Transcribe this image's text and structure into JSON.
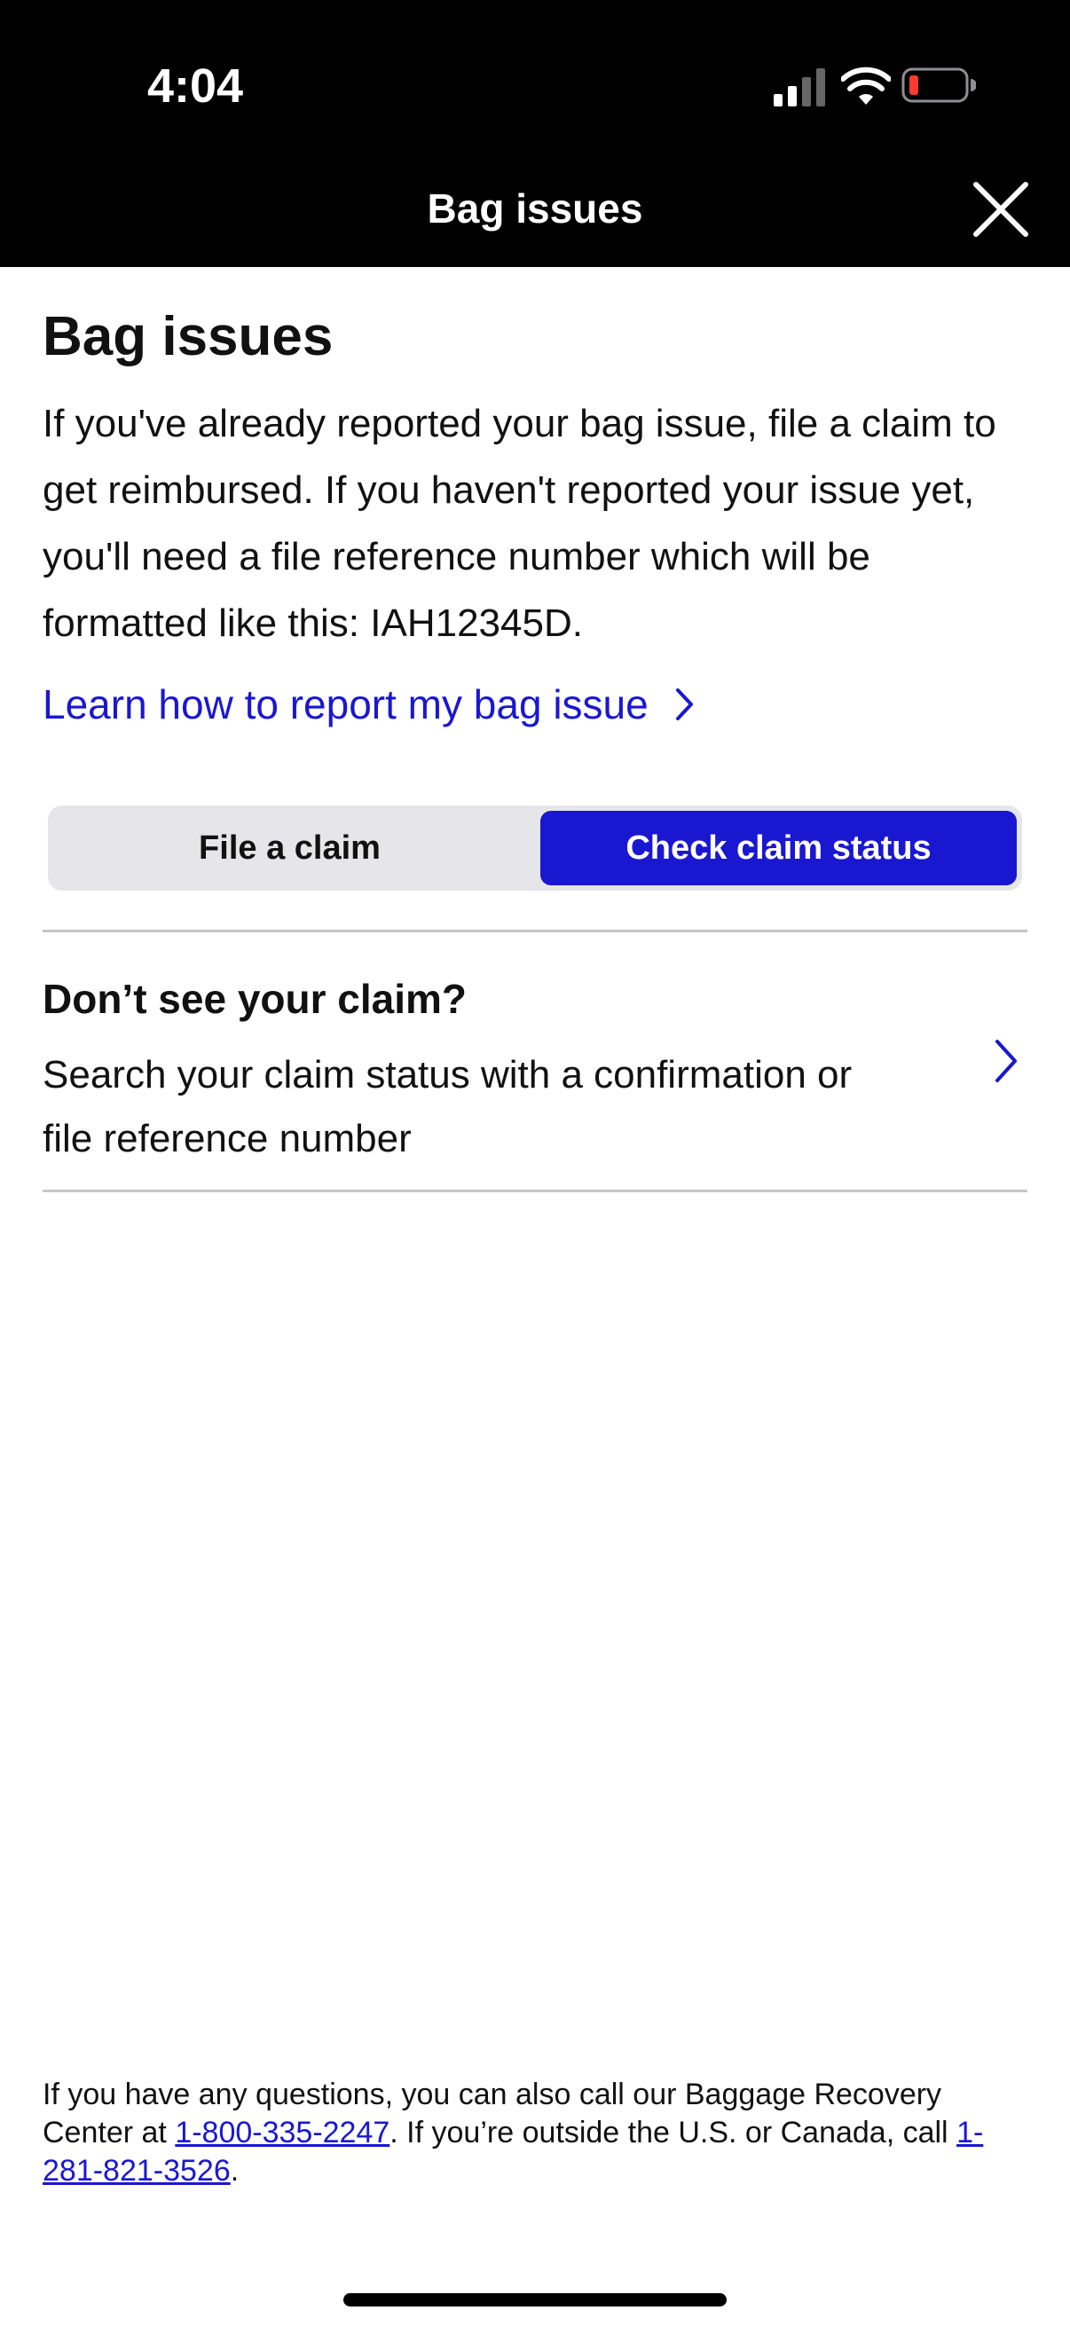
{
  "status_bar": {
    "time": "4:04",
    "icons": [
      "cellular-signal-icon",
      "wifi-icon",
      "battery-low-icon"
    ],
    "battery_color": "#ff3b30"
  },
  "header": {
    "title": "Bag issues",
    "close_icon": "close-icon"
  },
  "main": {
    "title": "Bag issues",
    "intro": "If you've already reported your bag issue, file a claim to get reimbursed. If you haven't reported your issue yet, you'll need a file reference number which will be formatted like this: IAH12345D.",
    "learn_link": "Learn how to report my bag issue"
  },
  "tabs": {
    "items": [
      {
        "label": "File a claim",
        "selected": false
      },
      {
        "label": "Check claim status",
        "selected": true
      }
    ]
  },
  "claim_search": {
    "heading": "Don’t see your claim?",
    "description": "Search your claim status with a confirmation or file reference number"
  },
  "footer": {
    "text_1": "If you have any questions, you can also call our Baggage Recovery Center at ",
    "phone_1": "1-800-335-2247",
    "text_2": ". If you’re outside the U.S. or Canada, call ",
    "phone_2": "1-281-821-3526",
    "text_3": "."
  },
  "colors": {
    "brand_blue": "#1a17d1",
    "header_bg": "#000000",
    "segment_bg": "#e6e6ea"
  }
}
